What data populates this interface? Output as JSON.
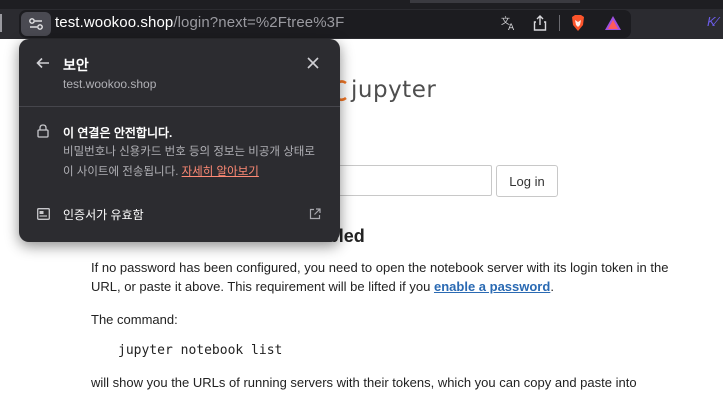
{
  "browser": {
    "url_host": "test.wookoo.shop",
    "url_path": "/login?next=%2Ftree%3F",
    "corner_text": "K∕"
  },
  "popup": {
    "title": "보안",
    "subtitle": "test.wookoo.shop",
    "connection_title": "이 연결은 안전합니다.",
    "connection_desc_1": "비밀번호나 신용카드 번호 등의 정보는 비공개 상태로",
    "connection_desc_2": "이 사이트에 전송됩니다. ",
    "learn_more": "자세히 알아보기",
    "certificate_label": "인증서가 유효함"
  },
  "page": {
    "logo_text": "jupyter",
    "login_button": "Log in",
    "heading": "Token authentication is enabled",
    "para1_a": "If no password has been configured, you need to open the notebook server with its login token in the URL, or paste it above. This requirement will be lifted if you ",
    "para1_link": "enable a password",
    "para1_end": ".",
    "para2": "The command:",
    "code": "jupyter notebook list",
    "para3": "will show you the URLs of running servers with their tokens, which you can copy and paste into"
  },
  "colors": {
    "popup_bg": "#2c2c30",
    "link_accent": "#ff8a75",
    "jupyter_orange": "#f37726",
    "page_link": "#2a6ab3"
  }
}
